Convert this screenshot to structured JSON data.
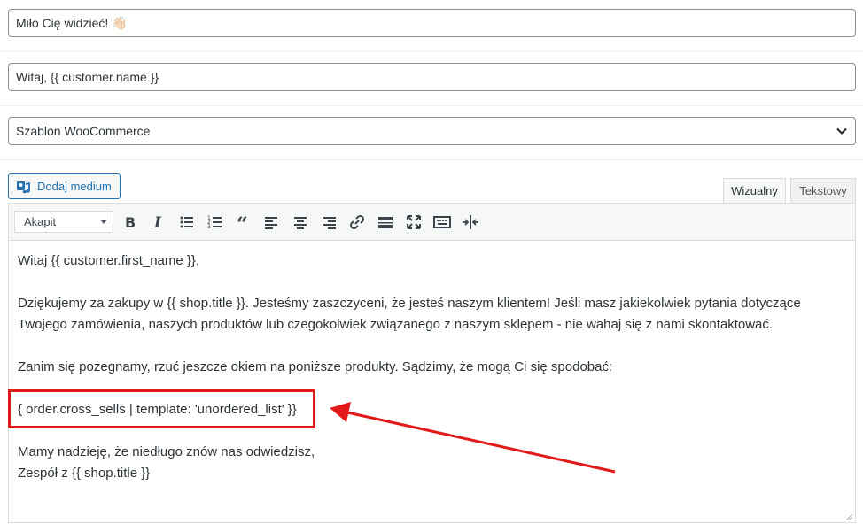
{
  "fields": {
    "heading_value": "Miło Cię widzieć! 👋🏻",
    "subject_value": "Witaj, {{ customer.name }}",
    "template_selected": "Szablon WooCommerce"
  },
  "media_button": {
    "label": "Dodaj medium",
    "icon": "media-icon"
  },
  "editor_tabs": [
    {
      "label": "Wizualny",
      "active": true
    },
    {
      "label": "Tekstowy",
      "active": false
    }
  ],
  "toolbar": {
    "format_select": "Akapit",
    "buttons": [
      "bold",
      "italic",
      "bullet-list",
      "numbered-list",
      "blockquote",
      "align-left",
      "align-center",
      "align-right",
      "insert-link",
      "read-more",
      "fullscreen",
      "toolbar-toggle",
      "insert-tag"
    ]
  },
  "content": {
    "greeting": "Witaj {{ customer.first_name }},",
    "thanks": "Dziękujemy za zakupy w {{ shop.title }}. Jesteśmy zaszczyceni, że jesteś naszym klientem! Jeśli masz jakiekolwiek pytania dotyczące Twojego zamówienia, naszych produktów lub czegokolwiek związanego z naszym sklepem - nie wahaj się z nami skontaktować.",
    "before_leaving": "Zanim się pożegnamy, rzuć jeszcze okiem na poniższe produkty. Sądzimy, że mogą Ci się spodobać:",
    "cross_sells": "{ order.cross_sells | template: 'unordered_list' }}",
    "hope_line": "Mamy nadzieję, że niedługo znów nas odwiedzisz,",
    "signature": "Zespół z {{ shop.title }}"
  },
  "colors": {
    "accent": "#2271b1",
    "highlight": "#e21a1a",
    "border": "#8c8f94"
  }
}
